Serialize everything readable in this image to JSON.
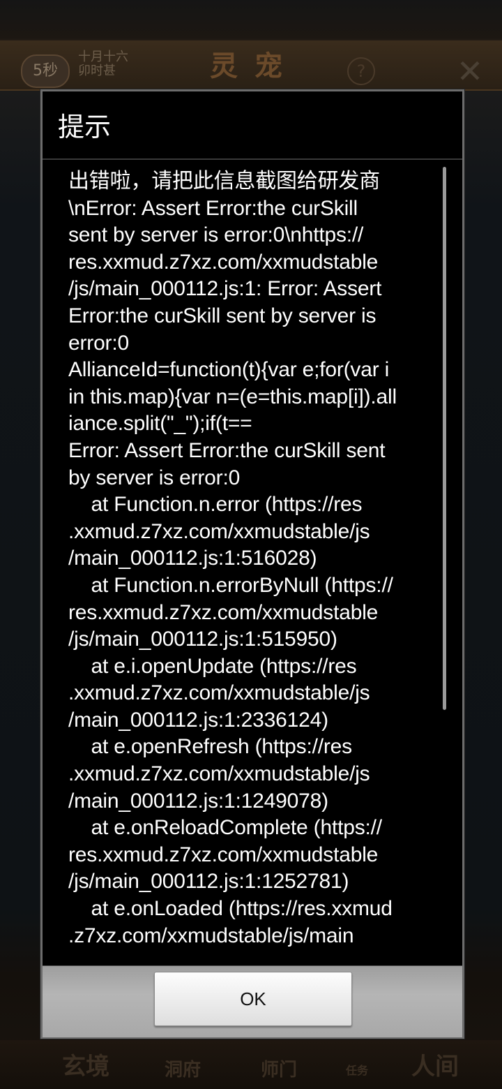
{
  "background": {
    "timer": "5秒",
    "date": "十月十六 卯时甚",
    "page_title": "灵宠",
    "help_glyph": "?",
    "close_glyph": "✕",
    "nav": {
      "item1": "玄境",
      "item2": "洞府",
      "item3": "师门",
      "item4": "任务",
      "item5": "人间"
    }
  },
  "dialog": {
    "title": "提示",
    "message": "出错啦，请把此信息截图给研发商\n\\nError: Assert Error:the curSkill\nsent by server is error:0\\nhttps://\nres.xxmud.z7xz.com/xxmudstable\n/js/main_000112.js:1: Error: Assert\nError:the curSkill sent by server is\nerror:0\nAllianceId=function(t){var e;for(var i\nin this.map){var n=(e=this.map[i]).all\niance.split(\"_\");if(t==\nError: Assert Error:the curSkill sent\nby server is error:0\n    at Function.n.error (https://res\n.xxmud.z7xz.com/xxmudstable/js\n/main_000112.js:1:516028)\n    at Function.n.errorByNull (https://\nres.xxmud.z7xz.com/xxmudstable\n/js/main_000112.js:1:515950)\n    at e.i.openUpdate (https://res\n.xxmud.z7xz.com/xxmudstable/js\n/main_000112.js:1:2336124)\n    at e.openRefresh (https://res\n.xxmud.z7xz.com/xxmudstable/js\n/main_000112.js:1:1249078)\n    at e.onReloadComplete (https://\nres.xxmud.z7xz.com/xxmudstable\n/js/main_000112.js:1:1252781)\n    at e.onLoaded (https://res.xxmud\n.z7xz.com/xxmudstable/js/main",
    "ok_label": "OK"
  }
}
